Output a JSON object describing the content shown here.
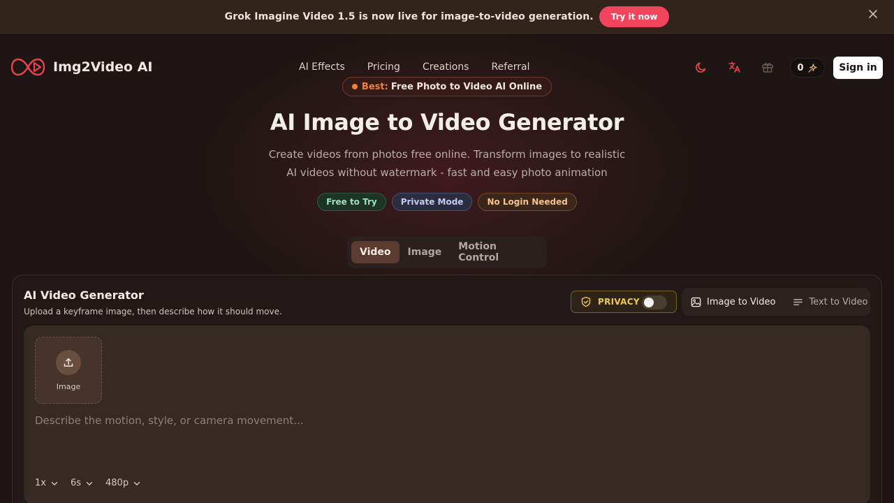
{
  "announcement": {
    "text": "Grok Imagine Video 1.5 is now live for image-to-video generation.",
    "cta": "Try it now"
  },
  "header": {
    "brand": "Img2Video AI",
    "nav": [
      "AI Effects",
      "Pricing",
      "Creations",
      "Referral"
    ],
    "credits": "0",
    "signin": "Sign in"
  },
  "hero": {
    "pill_label": "Best:",
    "pill_text": "Free Photo to Video AI Online",
    "title": "AI Image to Video Generator",
    "subtitle_line1": "Create videos from photos free online. Transform images to realistic",
    "subtitle_line2": "AI videos without watermark - fast and easy photo animation",
    "badges": [
      "Free to Try",
      "Private Mode",
      "No Login Needed"
    ]
  },
  "modes": {
    "tabs": [
      "Video",
      "Image",
      "Motion Control"
    ],
    "active": "Video"
  },
  "generator": {
    "title": "AI Video Generator",
    "subtitle": "Upload a keyframe image, then describe how it should move.",
    "privacy_label": "PRIVACY",
    "privacy_on": false,
    "submodes": [
      "Image to Video",
      "Text to Video"
    ],
    "upload_label": "Image",
    "prompt_placeholder": "Describe the motion, style, or camera movement...",
    "options": [
      "1x",
      "6s",
      "480p"
    ]
  },
  "colors": {
    "accent": "#f0455c",
    "brand_icon": "#e8434e",
    "privacy": "#f2c94c"
  }
}
